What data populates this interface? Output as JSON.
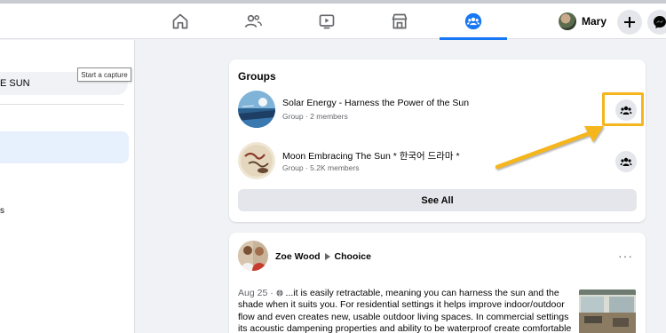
{
  "nav": {
    "tabs": [
      {
        "name": "home",
        "icon": "home-icon"
      },
      {
        "name": "friends",
        "icon": "friends-icon"
      },
      {
        "name": "watch",
        "icon": "video-icon"
      },
      {
        "name": "marketplace",
        "icon": "store-icon"
      },
      {
        "name": "groups",
        "icon": "groups-icon",
        "active": true
      }
    ],
    "profile_name": "Mary",
    "accent_color": "#1877f2"
  },
  "sidebar": {
    "search_fragment": "E SUN",
    "item_fragment": "s"
  },
  "tooltip": {
    "text": "Start a capture"
  },
  "groups_card": {
    "heading": "Groups",
    "groups": [
      {
        "title": "Solar Energy - Harness the Power of the Sun",
        "meta": "Group · 2 members"
      },
      {
        "title": "Moon Embracing The Sun * 한국어 드라마 *",
        "meta": "Group · 5.2K members"
      }
    ],
    "see_all_label": "See All",
    "highlight_color": "#f5b51d"
  },
  "post": {
    "author": "Zoe Wood",
    "group": "Chooice",
    "menu_label": "···",
    "date": "Aug 25 · ",
    "text": "...it is easily retractable, meaning you can harness the sun and the shade when it suits you. For residential settings it helps improve indoor/outdoor flow and even creates new, usable outdoor living spaces. In commercial settings its acoustic dampening properties and ability to be waterproof create comfortable ..."
  }
}
